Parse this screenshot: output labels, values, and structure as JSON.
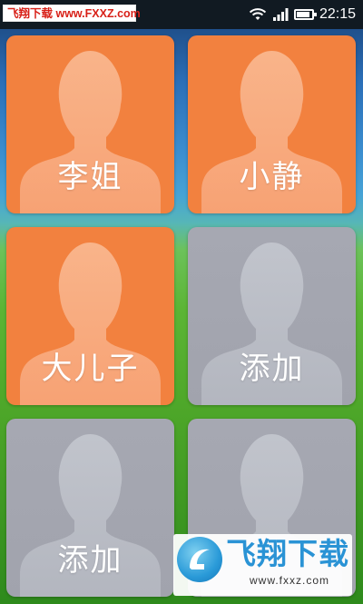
{
  "watermark_top": "飞翔下载 www.FXXZ.com",
  "status_bar": {
    "time": "22:15",
    "icons": [
      "wifi-icon",
      "signal-icon",
      "battery-icon"
    ],
    "battery_level": 0.9
  },
  "contacts": [
    {
      "label": "李姐",
      "state": "set",
      "color": "#f2813f"
    },
    {
      "label": "小静",
      "state": "set",
      "color": "#f2813f"
    },
    {
      "label": "大儿子",
      "state": "set",
      "color": "#f2813f"
    },
    {
      "label": "添加",
      "state": "empty",
      "color": "#a4a6b0"
    },
    {
      "label": "添加",
      "state": "empty",
      "color": "#a4a6b0"
    },
    {
      "label": "",
      "state": "empty",
      "color": "#a4a6b0"
    }
  ],
  "watermark_bottom": {
    "title": "飞翔下载",
    "url": "www.fxxz.com"
  }
}
